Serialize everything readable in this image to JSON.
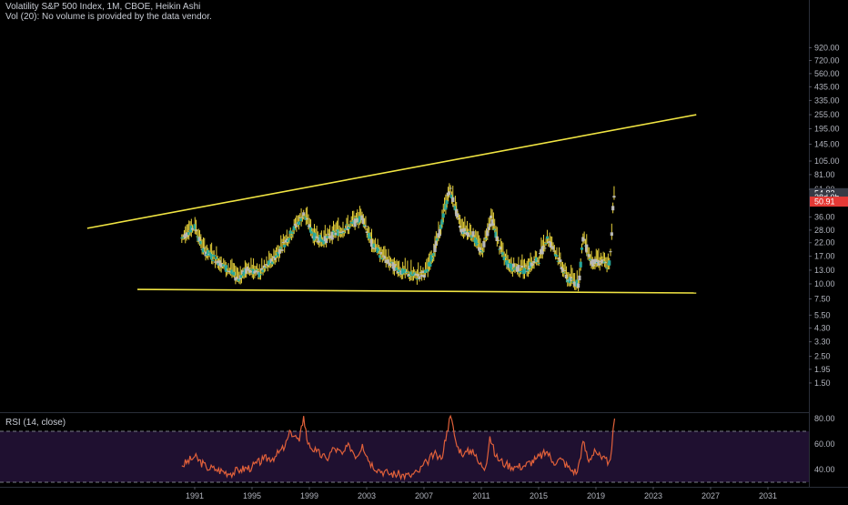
{
  "header": {
    "title": "Volatility S&P 500 Index, 1M, CBOE, Heikin Ashi",
    "volume_note": "Vol (20): No volume is provided by the data vendor."
  },
  "rsi": {
    "label": "RSI (14, close)"
  },
  "colors": {
    "background": "#000000",
    "trendline": "#f0e442",
    "candle_up": "#26a69a",
    "candle_down": "#b8b8b8",
    "wick": "#e8d23a",
    "rsi_line": "#e0603a",
    "rsi_band": "#2a1640",
    "price_badge": "#e53935",
    "neutral_badge": "#363a45"
  },
  "chart_data": [
    {
      "type": "candlestick",
      "title": "Volatility S&P 500 Index, 1M, CBOE, Heikin Ashi",
      "y_scale": "log",
      "y_ticks": [
        "920.00",
        "720.00",
        "560.00",
        "435.00",
        "335.00",
        "255.00",
        "195.00",
        "145.00",
        "105.00",
        "81.00",
        "61.00",
        "36.00",
        "28.00",
        "22.00",
        "17.00",
        "13.00",
        "10.00",
        "7.50",
        "5.50",
        "4.30",
        "3.30",
        "2.50",
        "1.95",
        "1.50"
      ],
      "x_ticks": [
        "1991",
        "1995",
        "1999",
        "2003",
        "2007",
        "2011",
        "2015",
        "2019",
        "2023",
        "2027",
        "2031"
      ],
      "last_value_labels": [
        {
          "text": "54.83",
          "role": "high"
        },
        {
          "text": "28d 0h",
          "role": "countdown"
        },
        {
          "text": "50.91",
          "role": "last_price"
        }
      ],
      "series": [
        {
          "points": [
            [
              1990.1,
              24
            ],
            [
              1991.0,
              30
            ],
            [
              1991.6,
              19
            ],
            [
              1992.5,
              16
            ],
            [
              1993.5,
              12.5
            ],
            [
              1994.0,
              11
            ],
            [
              1994.8,
              13.5
            ],
            [
              1995.5,
              12
            ],
            [
              1996.5,
              16
            ],
            [
              1997.5,
              24
            ],
            [
              1998.6,
              38
            ],
            [
              1999.3,
              25
            ],
            [
              2000.0,
              23
            ],
            [
              2001.0,
              27
            ],
            [
              2001.8,
              30
            ],
            [
              2002.7,
              36
            ],
            [
              2003.4,
              21
            ],
            [
              2004.5,
              15
            ],
            [
              2005.5,
              12.5
            ],
            [
              2006.5,
              11.5
            ],
            [
              2007.2,
              12.5
            ],
            [
              2008.0,
              24
            ],
            [
              2008.8,
              62
            ],
            [
              2009.6,
              28
            ],
            [
              2010.4,
              26
            ],
            [
              2011.0,
              18
            ],
            [
              2011.7,
              35
            ],
            [
              2012.4,
              18
            ],
            [
              2013.0,
              14
            ],
            [
              2014.0,
              13
            ],
            [
              2015.0,
              16
            ],
            [
              2015.6,
              24
            ],
            [
              2016.2,
              18
            ],
            [
              2017.0,
              11
            ],
            [
              2017.8,
              10
            ],
            [
              2018.1,
              24
            ],
            [
              2018.7,
              15
            ],
            [
              2019.5,
              15
            ],
            [
              2019.9,
              14
            ],
            [
              2020.05,
              19
            ],
            [
              2020.18,
              42
            ],
            [
              2020.25,
              54.83
            ],
            [
              2020.3,
              50.91
            ]
          ]
        }
      ],
      "trendlines": [
        {
          "name": "",
          "from": [
            1983.5,
            29
          ],
          "to": [
            2026.0,
            255
          ]
        },
        {
          "name": "",
          "from": [
            1987.0,
            9.0
          ],
          "to": [
            2026.0,
            8.4
          ]
        }
      ]
    },
    {
      "type": "line",
      "title": "RSI (14, close)",
      "y_ticks": [
        "80.00",
        "60.00",
        "40.00"
      ],
      "ylim": [
        27,
        86
      ],
      "bands": [
        30,
        70
      ],
      "series": [
        {
          "points": [
            [
              1990.1,
              43
            ],
            [
              1991.0,
              50
            ],
            [
              1991.8,
              42
            ],
            [
              1992.5,
              40
            ],
            [
              1993.5,
              37
            ],
            [
              1994.2,
              40
            ],
            [
              1995.0,
              42
            ],
            [
              1995.8,
              48
            ],
            [
              1996.6,
              50
            ],
            [
              1997.3,
              58
            ],
            [
              1997.7,
              70
            ],
            [
              1998.3,
              62
            ],
            [
              1998.6,
              82
            ],
            [
              1998.9,
              60
            ],
            [
              1999.5,
              54
            ],
            [
              2000.2,
              48
            ],
            [
              2000.7,
              57
            ],
            [
              2001.3,
              52
            ],
            [
              2001.8,
              59
            ],
            [
              2002.3,
              50
            ],
            [
              2002.7,
              60
            ],
            [
              2003.2,
              46
            ],
            [
              2003.8,
              40
            ],
            [
              2004.5,
              37
            ],
            [
              2005.3,
              36
            ],
            [
              2006.0,
              35
            ],
            [
              2006.6,
              38
            ],
            [
              2007.2,
              46
            ],
            [
              2007.7,
              52
            ],
            [
              2008.2,
              48
            ],
            [
              2008.6,
              70
            ],
            [
              2008.85,
              82
            ],
            [
              2009.3,
              58
            ],
            [
              2009.8,
              52
            ],
            [
              2010.4,
              56
            ],
            [
              2010.8,
              45
            ],
            [
              2011.3,
              42
            ],
            [
              2011.6,
              66
            ],
            [
              2012.0,
              50
            ],
            [
              2012.7,
              44
            ],
            [
              2013.4,
              42
            ],
            [
              2014.0,
              43
            ],
            [
              2014.8,
              48
            ],
            [
              2015.6,
              54
            ],
            [
              2016.0,
              46
            ],
            [
              2016.6,
              48
            ],
            [
              2017.2,
              40
            ],
            [
              2017.7,
              38
            ],
            [
              2018.1,
              62
            ],
            [
              2018.5,
              46
            ],
            [
              2018.9,
              56
            ],
            [
              2019.4,
              48
            ],
            [
              2019.9,
              46
            ],
            [
              2020.1,
              56
            ],
            [
              2020.2,
              72
            ],
            [
              2020.3,
              80
            ]
          ]
        }
      ]
    }
  ]
}
